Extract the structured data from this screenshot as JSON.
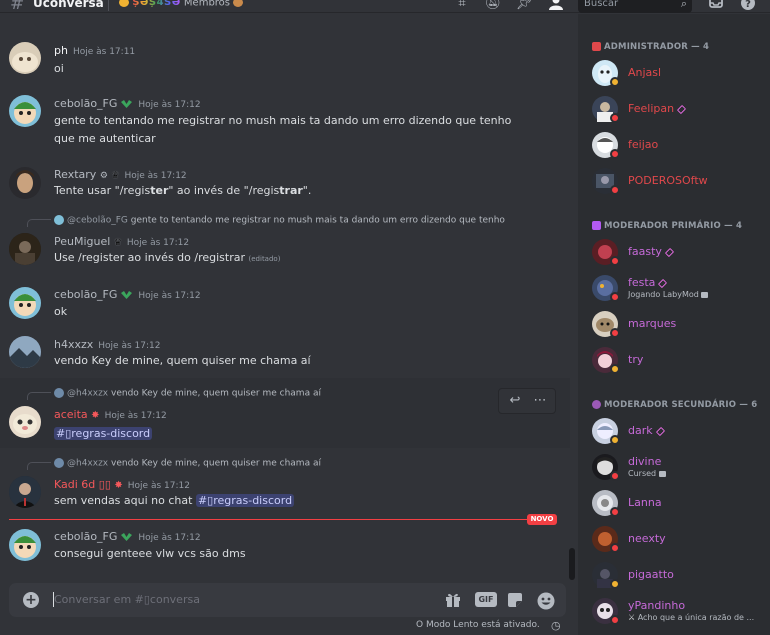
{
  "header": {
    "channel_name": "Ŭconversa",
    "topic_colored": "ȘƏȘ4ŠƏ",
    "topic_label": "Membros",
    "search_placeholder": "Buscar"
  },
  "messages": [
    {
      "author": "ph",
      "time": "Hoje às 17:11",
      "text": "oi",
      "name_color": "#f2f3f5"
    },
    {
      "author": "cebolão_FG",
      "time": "Hoje às 17:12",
      "text": "gente to tentando me registrar no mush mais ta dando um erro dizendo que tenho que me autenticar",
      "name_color": "#b5bac1"
    },
    {
      "author": "Rextary",
      "time": "Hoje às 17:12",
      "text_pre": "Tente usar \"/regis",
      "text_b1": "ter",
      "text_mid": "\" ao invés de \"/regis",
      "text_b2": "trar",
      "text_post": "\".",
      "name_color": "#b5bac1"
    },
    {
      "reply_author": "@cebolão_FG",
      "reply_text": "gente to tentando me registrar no mush mais ta dando um erro dizendo que tenho",
      "author": "PeuMiguel",
      "time": "Hoje às 17:12",
      "text": "Use /register ao invés do /registrar",
      "edited": "(editado)",
      "name_color": "#b5bac1"
    },
    {
      "author": "cebolão_FG",
      "time": "Hoje às 17:12",
      "text": "ok",
      "name_color": "#b5bac1"
    },
    {
      "author": "h4xxzx",
      "time": "Hoje às 17:12",
      "text": "vendo Key de mine, quem quiser me chama aí",
      "name_color": "#b5bac1"
    },
    {
      "reply_author": "@h4xxzx",
      "reply_text": "vendo Key de mine, quem quiser me chama aí",
      "author": "aceita",
      "time": "Hoje às 17:12",
      "channel_mention": "#▯regras-discord",
      "name_color": "#f5585b"
    },
    {
      "reply_author": "@h4xxzx",
      "reply_text": "vendo Key de mine, quem quiser me chama aí",
      "author": "Kadi 6d ▯▯",
      "time": "Hoje às 17:12",
      "text": "sem vendas aqui no chat",
      "channel_mention": "#▯regras-discord",
      "name_color": "#f5585b"
    },
    {
      "author": "cebolão_FG",
      "time": "Hoje às 17:12",
      "text": "consegui genteee vlw vcs são dms",
      "name_color": "#b5bac1"
    }
  ],
  "new_label": "NOVO",
  "composer": {
    "placeholder": "Conversar em #▯conversa",
    "gif_label": "GIF"
  },
  "slow_mode_text": "O Modo Lento está ativado.",
  "members": {
    "groups": [
      {
        "label": "ADMINISTRADOR — 4",
        "color": "#e0484b",
        "members": [
          {
            "name": "Anjasl",
            "color": "#e0484b",
            "status": "#f0b232"
          },
          {
            "name": "Feelipan",
            "color": "#e0484b",
            "status": "#f23f43",
            "boost": true
          },
          {
            "name": "feijao",
            "color": "#e0484b",
            "status": "#f23f43"
          },
          {
            "name": "PODEROSOftw",
            "color": "#e0484b",
            "status": "#f23f43"
          }
        ]
      },
      {
        "label": "MODERADOR PRIMÁRIO — 4",
        "color": "#b45af2",
        "members": [
          {
            "name": "faasty",
            "color": "#c66ad8",
            "status": "#f23f43",
            "boost": true
          },
          {
            "name": "festa",
            "color": "#c66ad8",
            "status": "#f23f43",
            "boost": true,
            "activity": "Jogando LabyMod"
          },
          {
            "name": "marques",
            "color": "#c66ad8",
            "status": "#f23f43"
          },
          {
            "name": "try",
            "color": "#c66ad8",
            "status": "#f0b232"
          }
        ]
      },
      {
        "label": "MODERADOR SECUNDÁRIO — 6",
        "color": "#9b59b6",
        "members": [
          {
            "name": "dark",
            "color": "#c66ad8",
            "status": "#f0b232",
            "boost": true
          },
          {
            "name": "divine",
            "color": "#c66ad8",
            "status": "#f23f43",
            "activity": "Cursed"
          },
          {
            "name": "Lanna",
            "color": "#c66ad8",
            "status": "#f23f43"
          },
          {
            "name": "neexty",
            "color": "#c66ad8",
            "status": "#f23f43"
          },
          {
            "name": "pigaatto",
            "color": "#c66ad8",
            "status": "#f0b232"
          },
          {
            "name": "yPandinho",
            "color": "#c66ad8",
            "status": "#f23f43",
            "activity": "Acho que a única razão de ..."
          }
        ]
      }
    ]
  }
}
